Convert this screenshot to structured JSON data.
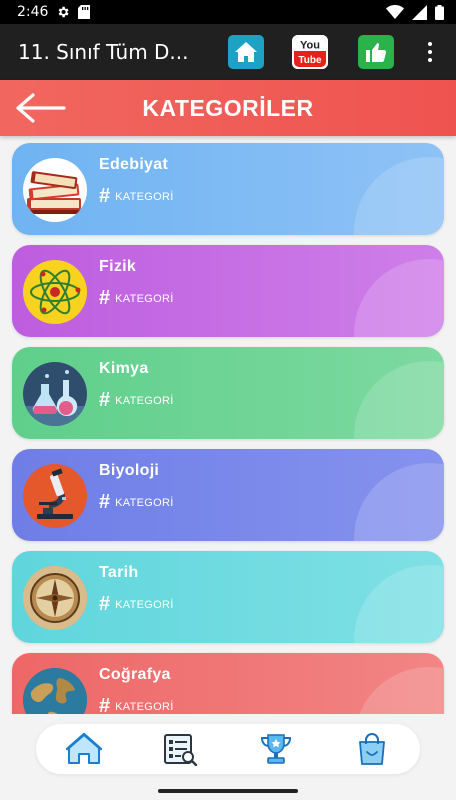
{
  "status_bar": {
    "time": "2:46",
    "icons": [
      "gear-icon",
      "sd-card-icon",
      "wifi-icon",
      "signal-icon",
      "battery-icon"
    ]
  },
  "app_bar": {
    "title": "11. Sınıf Tüm D...",
    "buttons": [
      {
        "name": "home-button",
        "icon": "house-icon",
        "color": "#1da1c4"
      },
      {
        "name": "youtube-button",
        "icon": "youtube-icon",
        "logo_text_top": "You",
        "logo_text_bottom": "Tube",
        "color": "#e62117"
      },
      {
        "name": "like-button",
        "icon": "thumbs-up-icon",
        "color": "#2ab34a"
      }
    ],
    "overflow_icon": "more-vert-icon"
  },
  "header": {
    "title": "KATEGORİLER",
    "back_icon": "arrow-left-icon",
    "color": "#ef5350"
  },
  "categories": [
    {
      "name": "Edebiyat",
      "tag": "KATEGORİ",
      "icon": "books-icon",
      "gradient": [
        "#6fb3f2",
        "#8ec2f6"
      ]
    },
    {
      "name": "Fizik",
      "tag": "KATEGORİ",
      "icon": "atom-icon",
      "gradient": [
        "#bd5ddf",
        "#cf7fe9"
      ]
    },
    {
      "name": "Kimya",
      "tag": "KATEGORİ",
      "icon": "flasks-icon",
      "gradient": [
        "#5fcf8b",
        "#7dd9a0"
      ]
    },
    {
      "name": "Biyoloji",
      "tag": "KATEGORİ",
      "icon": "microscope-icon",
      "gradient": [
        "#6e7ee6",
        "#8592ee"
      ]
    },
    {
      "name": "Tarih",
      "tag": "KATEGORİ",
      "icon": "compass-icon",
      "gradient": [
        "#5fd6dc",
        "#7fe0e5"
      ]
    },
    {
      "name": "Coğrafya",
      "tag": "KATEGORİ",
      "icon": "globe-icon",
      "gradient": [
        "#ee6767",
        "#f28585"
      ]
    }
  ],
  "bottom_nav": [
    {
      "name": "nav-home",
      "icon": "house-icon"
    },
    {
      "name": "nav-quiz",
      "icon": "checklist-search-icon"
    },
    {
      "name": "nav-trophy",
      "icon": "trophy-icon"
    },
    {
      "name": "nav-shop",
      "icon": "shopping-bag-icon"
    }
  ]
}
